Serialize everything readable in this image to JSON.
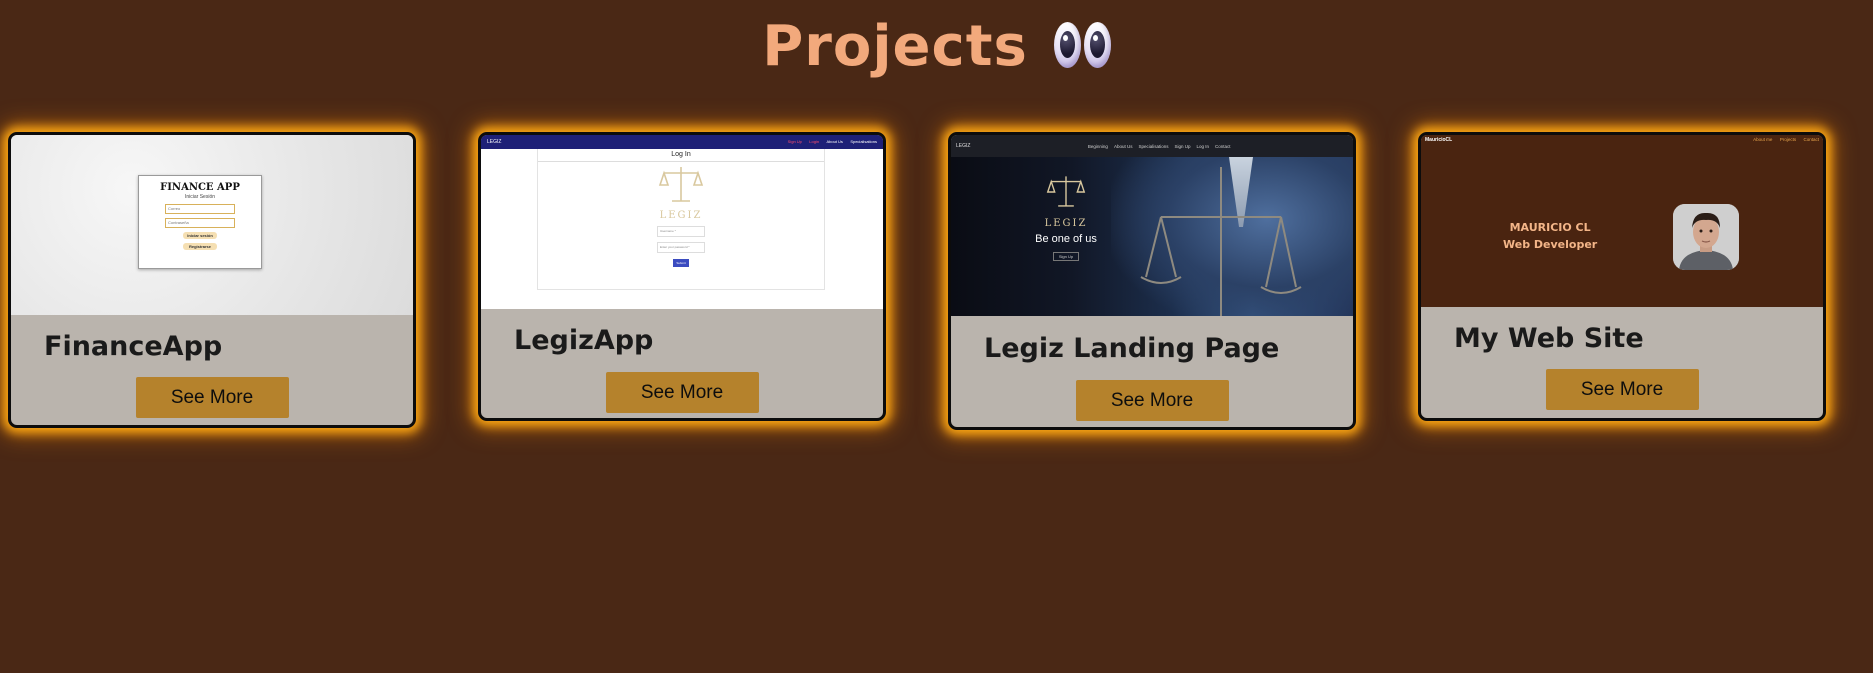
{
  "page": {
    "heading": "Projects",
    "heading_icon": "eyes-emoji-icon"
  },
  "projects": [
    {
      "title": "FinanceApp",
      "button": "See More",
      "preview": {
        "app_title": "FINANCE APP",
        "subtitle": "Iniciar Sesión",
        "input_email": "Correo",
        "input_password": "Contraseña",
        "btn_login": "Iniciar sesión",
        "btn_register": "Registrarse"
      }
    },
    {
      "title": "LegizApp",
      "button": "See More",
      "preview": {
        "brand": "LEGIZ",
        "nav": [
          "Sign Up",
          "Login",
          "About Us",
          "Specialisations"
        ],
        "login_title": "Log In",
        "logo_word": "LEGIZ",
        "input_user": "Username *",
        "input_password": "Enter your password *",
        "submit": "Submit"
      }
    },
    {
      "title": "Legiz Landing Page",
      "button": "See More",
      "preview": {
        "brand": "LEGIZ",
        "nav": [
          "Beginning",
          "About Us",
          "Specialisations",
          "Sign Up",
          "Log In",
          "Contact"
        ],
        "logo_word": "LEGIZ",
        "tagline": "Be one of us",
        "cta": "Sign Up"
      }
    },
    {
      "title": "My Web Site",
      "button": "See More",
      "preview": {
        "brand": "MauricioCL",
        "nav": [
          "About me",
          "Projects",
          "Contact"
        ],
        "name": "MAURICIO CL",
        "role": "Web Developer"
      }
    }
  ],
  "colors": {
    "background": "#4a2815",
    "heading": "#f2a97c",
    "card_body": "#bab4ad",
    "button": "#b5822c",
    "glow": "#ffaa14"
  }
}
